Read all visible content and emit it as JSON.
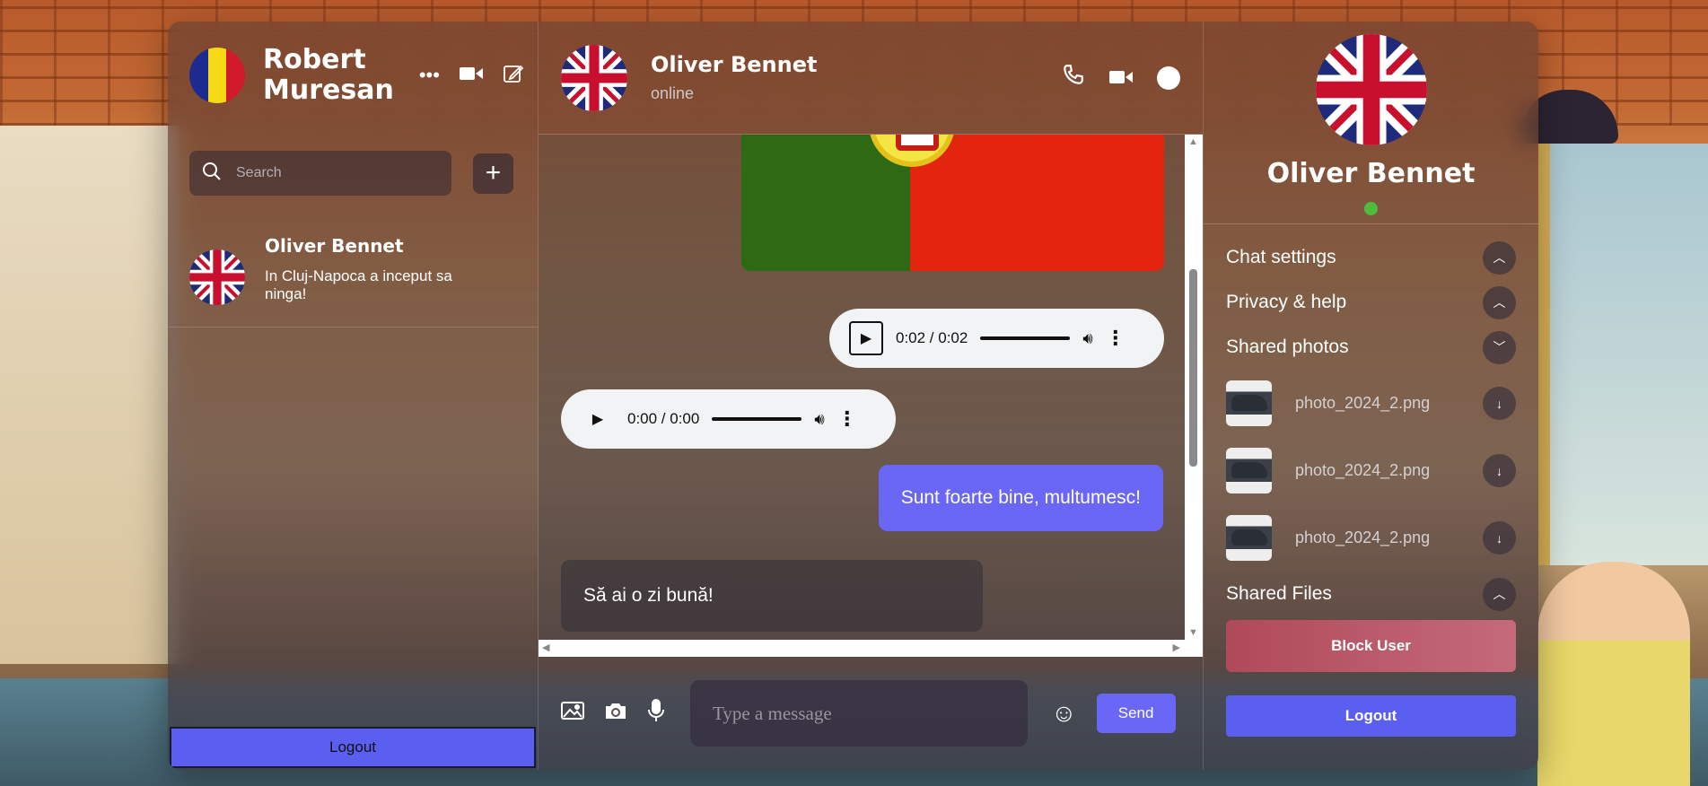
{
  "current_user": {
    "name": "Robert Muresan"
  },
  "header_icons": {
    "more": "more-icon",
    "video": "video-icon",
    "compose": "compose-icon"
  },
  "search": {
    "placeholder": "Search"
  },
  "chats": [
    {
      "name": "Oliver Bennet",
      "preview": "In Cluj-Napoca a inceput sa ninga!"
    }
  ],
  "left_logout": "Logout",
  "conversation": {
    "contact_name": "Oliver Bennet",
    "status": "online",
    "audio_1": {
      "time": "0:02 / 0:02"
    },
    "audio_2": {
      "time": "0:00 / 0:00"
    },
    "message_out": "Sunt foarte bine, multumesc!",
    "message_in": "Să ai o zi bună!"
  },
  "composer": {
    "placeholder": "Type a message",
    "send_label": "Send"
  },
  "profile": {
    "name": "Oliver Bennet",
    "sections": {
      "chat_settings": "Chat settings",
      "privacy": "Privacy & help",
      "shared_photos": "Shared photos",
      "shared_files": "Shared Files"
    },
    "photos": [
      {
        "name": "photo_2024_2.png"
      },
      {
        "name": "photo_2024_2.png"
      },
      {
        "name": "photo_2024_2.png"
      }
    ],
    "block_label": "Block User",
    "logout_label": "Logout"
  },
  "colors": {
    "accent": "#6b67f6",
    "logout": "#5b5ff0",
    "online": "#4ebd3b",
    "block": "#b04a5a"
  }
}
